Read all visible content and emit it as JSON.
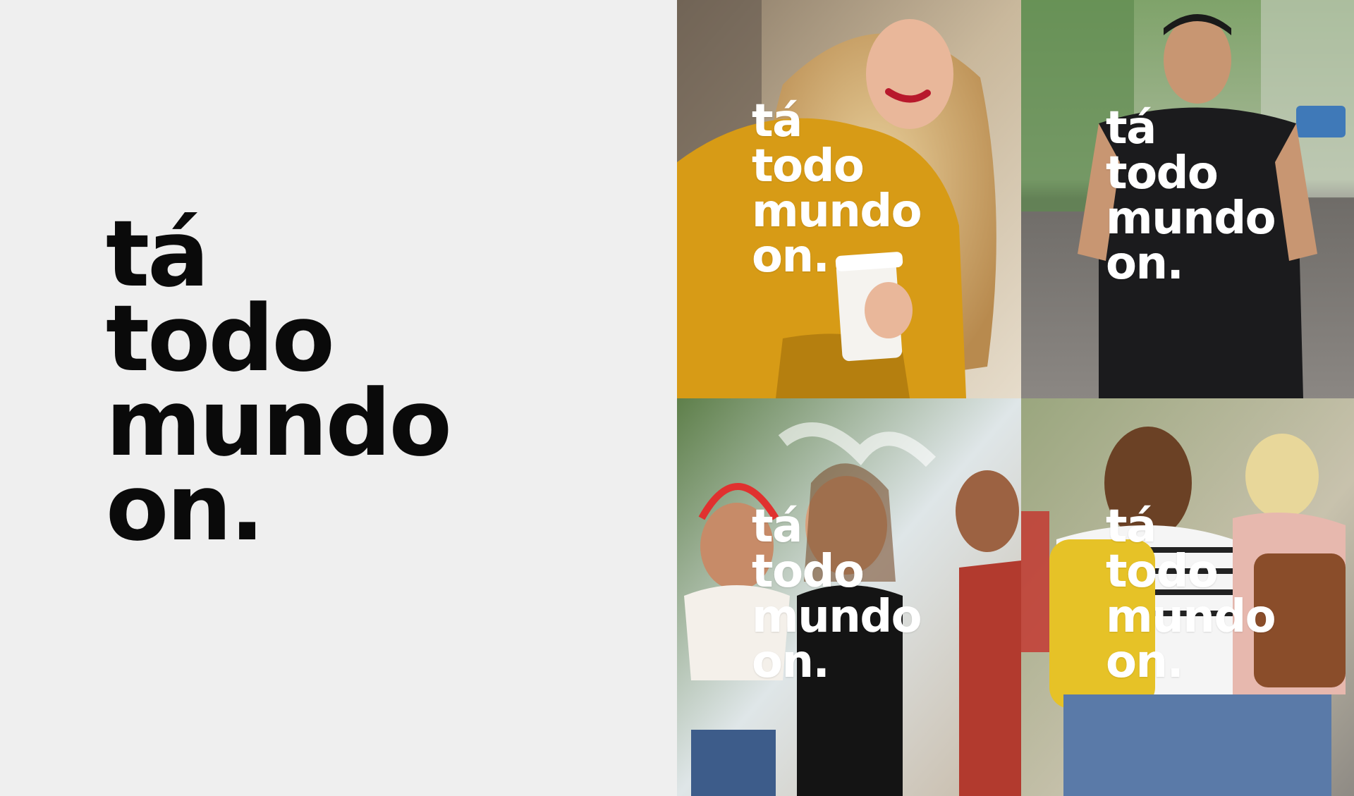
{
  "main": {
    "headline_lines": [
      "tá",
      "todo",
      "mundo",
      "on."
    ]
  },
  "tiles": [
    {
      "lines": [
        "tá",
        "todo",
        "mundo",
        "on."
      ],
      "photo": "woman-yellow-hoodie-coffee-photo"
    },
    {
      "lines": [
        "tá",
        "todo",
        "mundo",
        "on."
      ],
      "photo": "man-black-tshirt-street-photo"
    },
    {
      "lines": [
        "tá",
        "todo",
        "mundo",
        "on."
      ],
      "photo": "women-headphones-fountain-photo"
    },
    {
      "lines": [
        "tá",
        "todo",
        "mundo",
        "on."
      ],
      "photo": "friends-backpacks-walking-photo"
    }
  ],
  "colors": {
    "background": "#efefef",
    "headline": "#0a0a0a",
    "overlay_text": "#ffffff"
  }
}
